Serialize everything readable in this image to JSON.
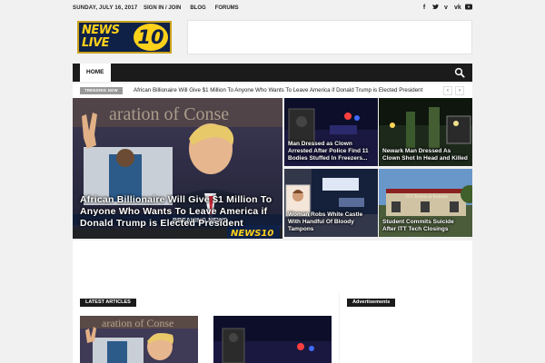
{
  "topbar": {
    "date": "SUNDAY, JULY 16, 2017",
    "links": [
      "SIGN IN / JOIN",
      "BLOG",
      "FORUMS"
    ],
    "social_icons": [
      "facebook-icon",
      "twitter-icon",
      "vimeo-icon",
      "vk-icon",
      "youtube-icon"
    ]
  },
  "logo": {
    "line1": "NEWS",
    "line2": "LIVE",
    "number": "10"
  },
  "nav": {
    "home": "HOME",
    "search_icon": "search-icon"
  },
  "ticker": {
    "label": "TRENDING NOW",
    "headline": "African Billionaire Will Give $1 Million To Anyone Who Wants To Leave America if Donald Trump is Elected President"
  },
  "hero": {
    "headline": "African Billionaire Will Give $1 Million To Anyone Who Wants To Leave America if Donald Trump is Elected President"
  },
  "tiles": [
    {
      "headline": "Man Dressed as Clown Arrested After Police Find 11 Bodies Stuffed In Freezers..."
    },
    {
      "headline": "Newark Man Dressed As Clown Shot In Head and Killed"
    },
    {
      "headline": "Woman Robs White Castle With Handful Of Bloody Tampons"
    },
    {
      "headline": "Student Commits Suicide After ITT Tech Closings"
    }
  ],
  "sections": {
    "latest": "LATEST ARTICLES",
    "ads": "Advertisements"
  },
  "colors": {
    "nav_bg": "#1b1b1b",
    "logo_yellow": "#ffd21a",
    "logo_blue": "#0f2147",
    "accent_red": "#d9231d"
  }
}
